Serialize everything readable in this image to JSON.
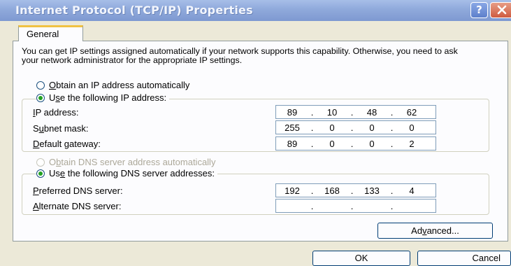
{
  "window": {
    "title": "Internet Protocol (TCP/IP) Properties",
    "help_glyph": "?",
    "close_icon": "close-icon"
  },
  "tabs": [
    {
      "label": "General",
      "selected": true
    }
  ],
  "intro_text": "You can get IP settings assigned automatically if your network supports this capability. Otherwise, you need to ask your network administrator for the appropriate IP settings.",
  "ip_section": {
    "obtain_auto": {
      "label_mnemonic": "O",
      "label_rest": "btain an IP address automatically",
      "checked": false
    },
    "use_following": {
      "label_pre": "U",
      "label_mnemonic": "s",
      "label_rest": "e the following IP address:",
      "checked": true
    },
    "fields": [
      {
        "label_pre": "",
        "label_mnemonic": "I",
        "label_rest": "P address:",
        "octets": [
          "89",
          "10",
          "48",
          "62"
        ]
      },
      {
        "label_pre": "S",
        "label_mnemonic": "u",
        "label_rest": "bnet mask:",
        "octets": [
          "255",
          "0",
          "0",
          "0"
        ]
      },
      {
        "label_pre": "",
        "label_mnemonic": "D",
        "label_rest": "efault gateway:",
        "octets": [
          "89",
          "0",
          "0",
          "2"
        ]
      }
    ]
  },
  "dns_section": {
    "obtain_auto": {
      "label_pre": "O",
      "label_mnemonic": "b",
      "label_rest": "tain DNS server address automatically",
      "checked": false,
      "disabled": true
    },
    "use_following": {
      "label_pre": "Us",
      "label_mnemonic": "e",
      "label_rest": " the following DNS server addresses:",
      "checked": true
    },
    "fields": [
      {
        "label_pre": "",
        "label_mnemonic": "P",
        "label_rest": "referred DNS server:",
        "octets": [
          "192",
          "168",
          "133",
          "4"
        ]
      },
      {
        "label_pre": "",
        "label_mnemonic": "A",
        "label_rest": "lternate DNS server:",
        "octets": [
          "",
          "",
          "",
          ""
        ]
      }
    ]
  },
  "buttons": {
    "advanced": {
      "pre": "Ad",
      "mnemonic": "v",
      "rest": "anced..."
    },
    "ok": "OK",
    "cancel": "Cancel"
  },
  "octet_separator": "."
}
